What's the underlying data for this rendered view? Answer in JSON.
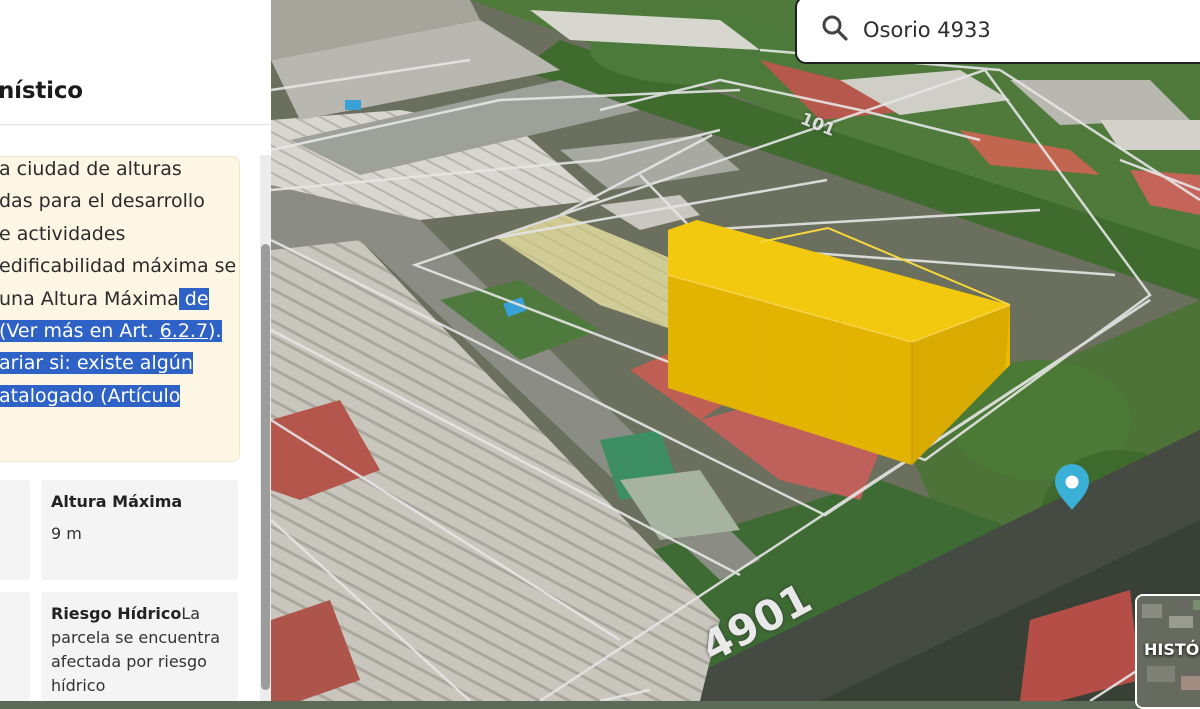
{
  "panel": {
    "title": "nístico",
    "info": {
      "lines": [
        {
          "plain": "a ciudad de alturas",
          "sel": ""
        },
        {
          "plain": "das para el desarrollo",
          "sel": ""
        },
        {
          "plain": "e actividades",
          "sel": ""
        },
        {
          "plain": "edificabilidad máxima se",
          "sel": ""
        },
        {
          "plain": "una Altura Máxima",
          "sel": " de"
        },
        {
          "plain": "",
          "sel": " (Ver más en Art. ",
          "link": "6.2.7",
          "tail": ")."
        },
        {
          "plain": "",
          "sel": "ariar si: existe algún"
        },
        {
          "plain": "",
          "sel": "atalogado (Artículo"
        }
      ]
    },
    "cards": {
      "altura": {
        "title": "Altura Máxima",
        "value": "9 m"
      },
      "riesgo": {
        "title": "Riesgo Hídrico",
        "value_lines": [
          "La",
          "parcela se encuentra",
          "afectada por riesgo",
          "hídrico"
        ]
      }
    }
  },
  "search": {
    "value": "Osorio 4933",
    "placeholder": ""
  },
  "map": {
    "street_labels": [
      "101",
      "4901"
    ],
    "history_label": "HISTÓR",
    "colors": {
      "building": "#f2c400",
      "pin": "#3ab0d6"
    }
  }
}
